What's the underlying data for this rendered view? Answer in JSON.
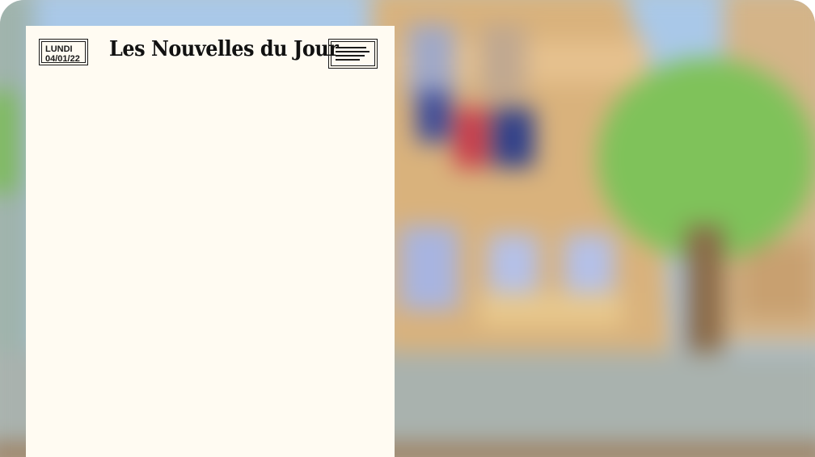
{
  "newspaper": {
    "day": "LUNDI",
    "date": "04/01/22",
    "title": "Les Nouvelles du Jour",
    "menu_icon": "newspaper-lines-icon"
  },
  "scene": {
    "description_icon": "town-hall-background",
    "colors": {
      "sky": "#a9c8e8",
      "building": "#d9b27c",
      "tree": "#7fc25a",
      "ground": "#a9b2ae",
      "flag_blue": "#3a4a9a",
      "flag_red": "#c83a4a"
    }
  }
}
